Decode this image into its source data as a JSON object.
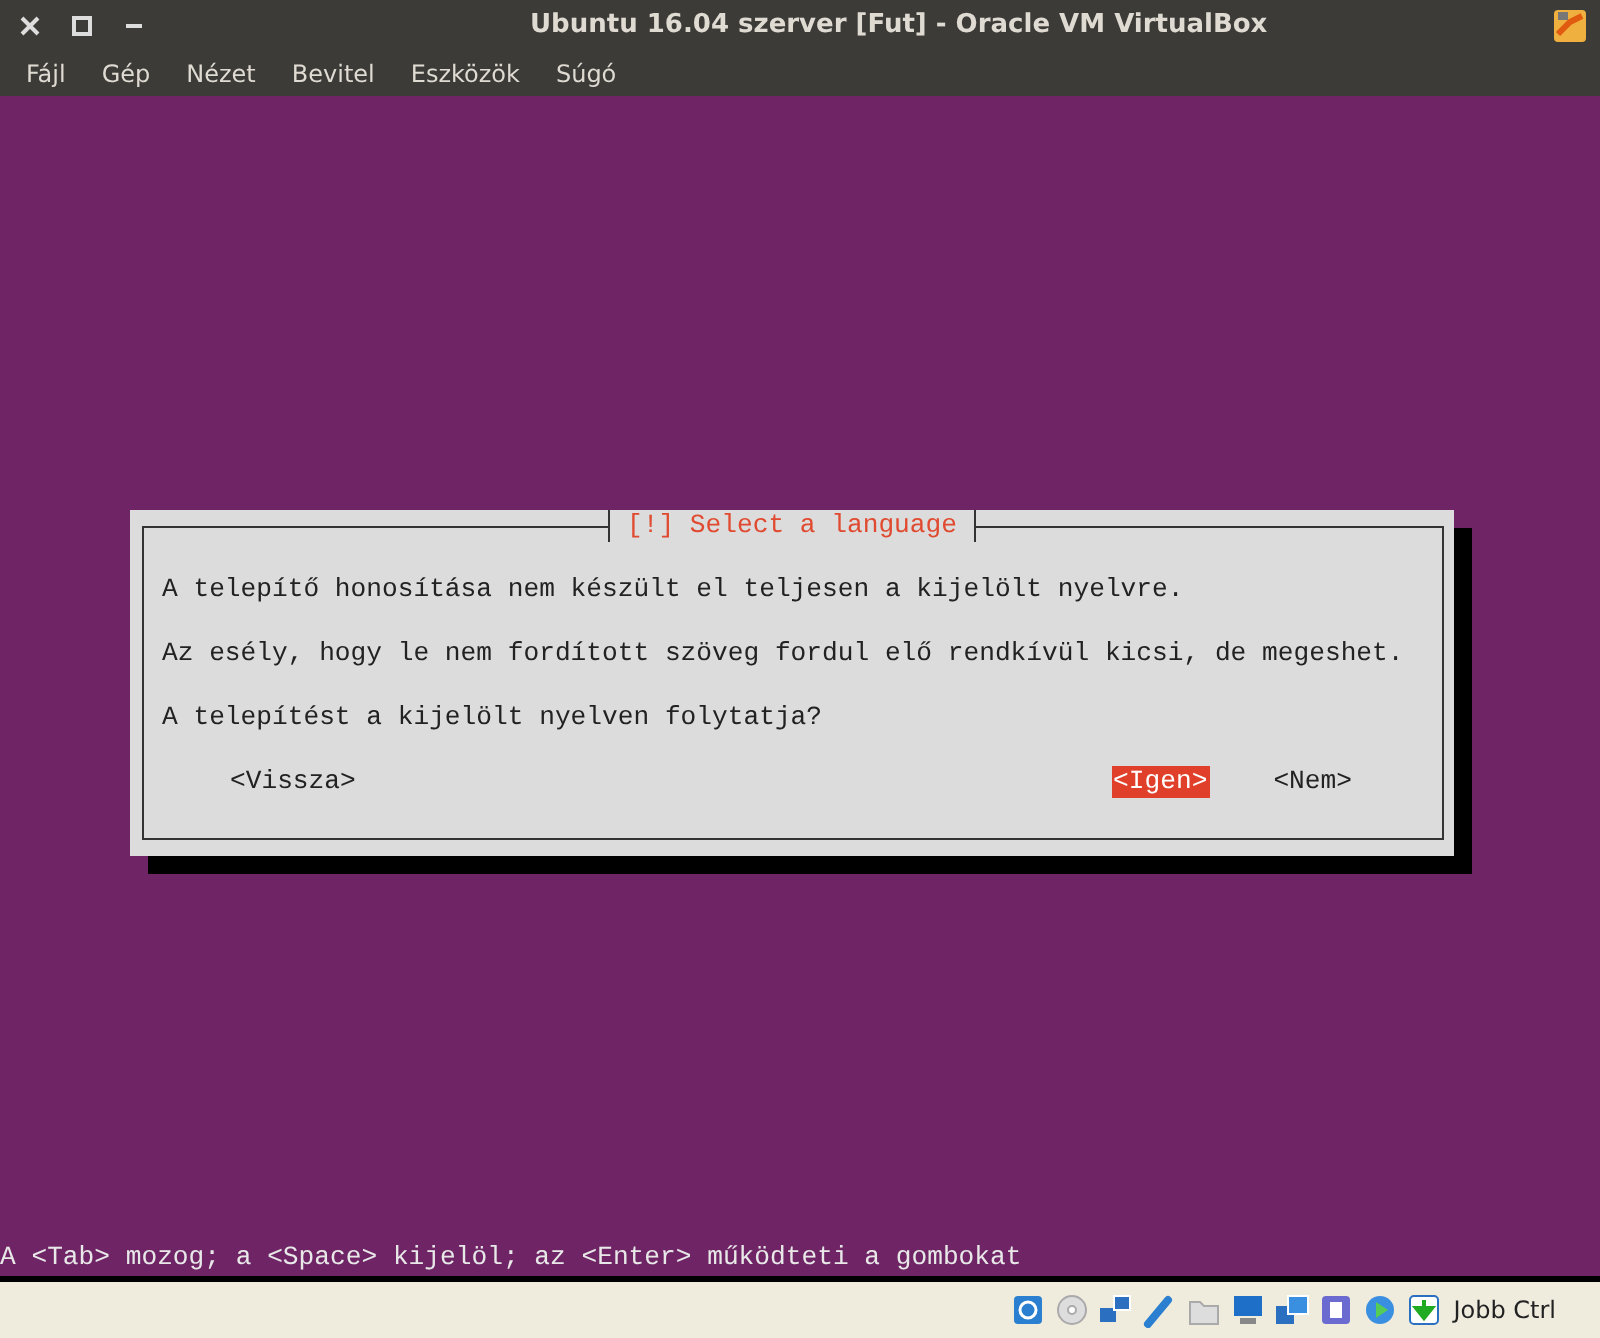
{
  "window": {
    "title": "Ubuntu 16.04 szerver [Fut] - Oracle VM VirtualBox"
  },
  "menu": [
    "Fájl",
    "Gép",
    "Nézet",
    "Bevitel",
    "Eszközök",
    "Súgó"
  ],
  "dialog": {
    "title": "[!] Select a language",
    "paragraphs": [
      "A telepítő honosítása nem készült el teljesen a kijelölt nyelvre.",
      "Az esély, hogy le nem fordított szöveg fordul elő rendkívül kicsi, de megeshet.",
      "A telepítést a kijelölt nyelven folytatja?"
    ],
    "buttons": [
      {
        "label": "<Vissza>",
        "selected": false
      },
      {
        "label": "<Igen>",
        "selected": true
      },
      {
        "label": "<Nem>",
        "selected": false
      }
    ]
  },
  "hint": "A <Tab> mozog; a <Space> kijelöl; az <Enter> működteti a gombokat",
  "status_bar": {
    "host_key": "Jobb Ctrl"
  }
}
